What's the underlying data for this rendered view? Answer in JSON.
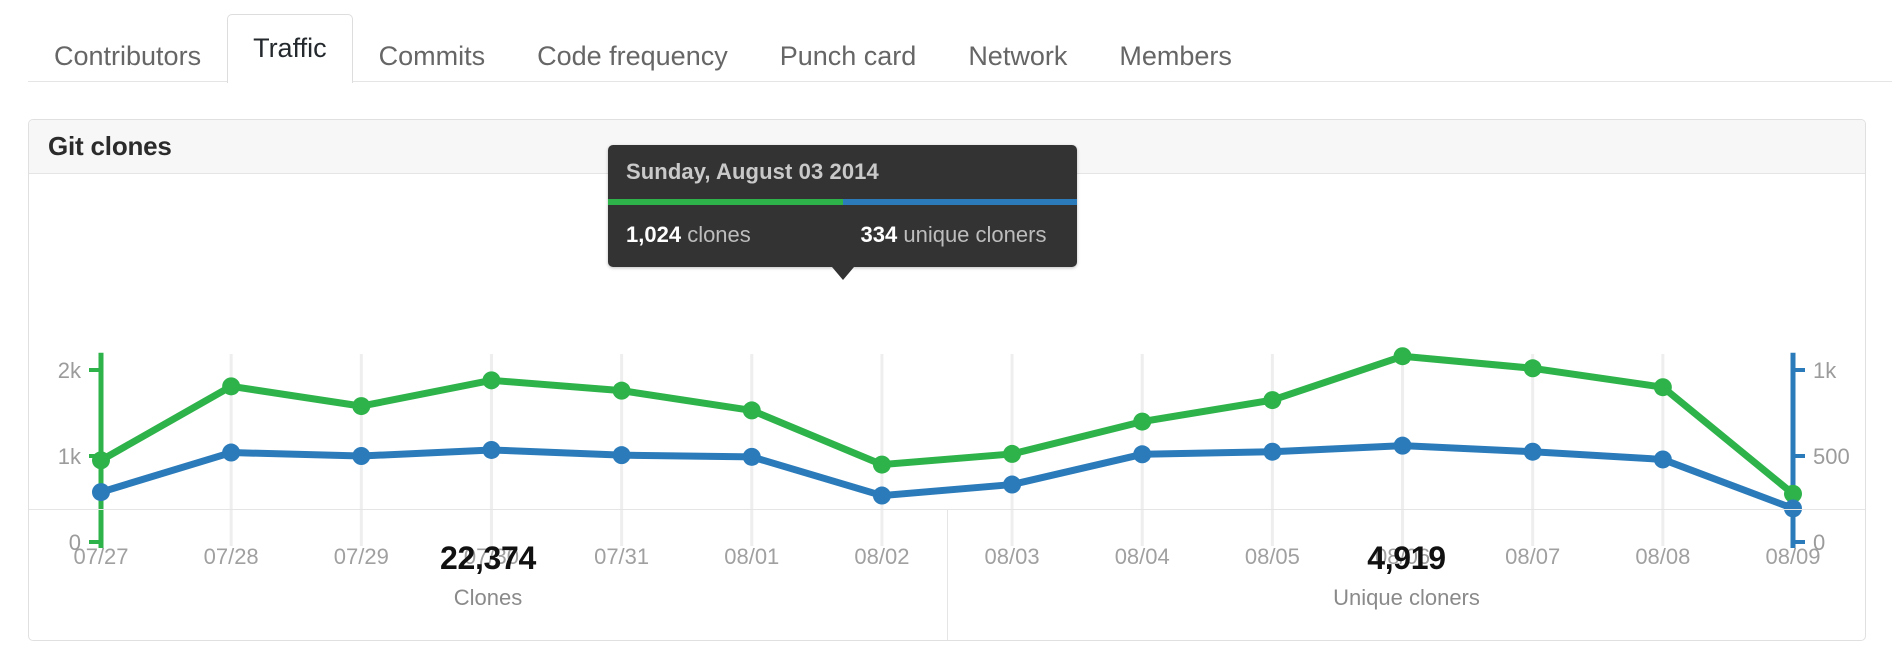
{
  "tabs": [
    {
      "label": "Contributors",
      "active": false
    },
    {
      "label": "Traffic",
      "active": true
    },
    {
      "label": "Commits",
      "active": false
    },
    {
      "label": "Code frequency",
      "active": false
    },
    {
      "label": "Punch card",
      "active": false
    },
    {
      "label": "Network",
      "active": false
    },
    {
      "label": "Members",
      "active": false
    }
  ],
  "card": {
    "title": "Git clones"
  },
  "tooltip": {
    "date": "Sunday, August 03 2014",
    "left": {
      "value": "1,024",
      "label": "clones",
      "color": "#2eb34a"
    },
    "right": {
      "value": "334",
      "label": "unique cloners",
      "color": "#2b7bba"
    }
  },
  "footer": {
    "stats": [
      {
        "value": "22,374",
        "label": "Clones"
      },
      {
        "value": "4,919",
        "label": "Unique cloners"
      }
    ]
  },
  "chart_data": {
    "type": "line",
    "title": "Git clones",
    "xlabel": "",
    "ylabel": "",
    "grid": true,
    "legend_position": "none",
    "x": [
      "07/27",
      "07/28",
      "07/29",
      "07/30",
      "07/31",
      "08/01",
      "08/02",
      "08/03",
      "08/04",
      "08/05",
      "08/06",
      "08/07",
      "08/08",
      "08/09"
    ],
    "categories": [
      "07/27",
      "07/28",
      "07/29",
      "07/30",
      "07/31",
      "08/01",
      "08/02",
      "08/03",
      "08/04",
      "08/05",
      "08/06",
      "08/07",
      "08/08",
      "08/09"
    ],
    "axes": {
      "left": {
        "name": "clones",
        "color": "#2eb34a",
        "ticks": [
          0,
          1000,
          2000
        ],
        "ticklabels": [
          "0",
          "1k",
          "2k"
        ],
        "ylim": [
          0,
          2400
        ]
      },
      "right": {
        "name": "unique cloners",
        "color": "#2b7bba",
        "ticks": [
          0,
          500,
          1000
        ],
        "ticklabels": [
          "0",
          "500",
          "1k"
        ],
        "ylim": [
          0,
          1200
        ]
      }
    },
    "series": [
      {
        "name": "clones",
        "color": "#2eb34a",
        "axis": "left",
        "values": [
          950,
          1810,
          1580,
          1880,
          1760,
          1530,
          900,
          1024,
          1400,
          1650,
          2160,
          2020,
          1800,
          560
        ]
      },
      {
        "name": "unique cloners",
        "color": "#2b7bba",
        "axis": "right",
        "values": [
          290,
          520,
          500,
          535,
          505,
          495,
          270,
          334,
          510,
          525,
          560,
          525,
          480,
          195
        ]
      }
    ],
    "annotations": [
      {
        "x": "08/03",
        "text": "Sunday, August 03 2014",
        "clones": 1024,
        "unique_cloners": 334
      }
    ],
    "totals": {
      "clones": 22374,
      "unique_cloners": 4919
    }
  }
}
